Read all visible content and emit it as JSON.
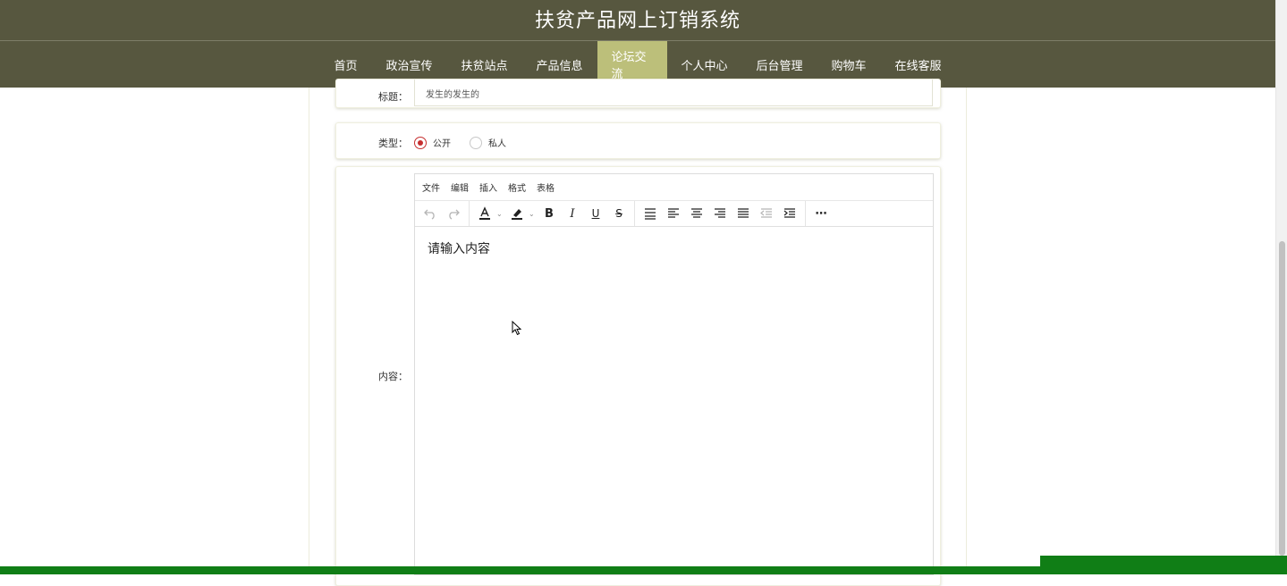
{
  "app": {
    "title": "扶贫产品网上订销系统"
  },
  "nav": {
    "items": [
      {
        "label": "首页"
      },
      {
        "label": "政治宣传"
      },
      {
        "label": "扶贫站点"
      },
      {
        "label": "产品信息"
      },
      {
        "label": "论坛交流",
        "active": true
      },
      {
        "label": "个人中心"
      },
      {
        "label": "后台管理"
      },
      {
        "label": "购物车"
      },
      {
        "label": "在线客服"
      }
    ]
  },
  "form": {
    "title_label": "标题：",
    "title_value": "发生的发生的",
    "type_label": "类型：",
    "type_options": [
      {
        "label": "公开",
        "checked": true
      },
      {
        "label": "私人",
        "checked": false
      }
    ],
    "content_label": "内容："
  },
  "editor": {
    "menus": [
      "文件",
      "编辑",
      "插入",
      "格式",
      "表格"
    ],
    "placeholder": "请输入内容",
    "toolbar_icons": [
      "undo-icon",
      "redo-icon",
      "font-color-icon",
      "highlight-icon",
      "bold-icon",
      "italic-icon",
      "underline-icon",
      "strikethrough-icon",
      "list-icon",
      "align-left-icon",
      "align-center-icon",
      "align-right-icon",
      "align-justify-icon",
      "outdent-icon",
      "indent-icon",
      "more-icon"
    ]
  },
  "colors": {
    "header_bg": "#57573f",
    "nav_active_bg": "#bcbf7a",
    "radio_accent": "#c62f2f",
    "bottom_bar": "#107e16"
  }
}
